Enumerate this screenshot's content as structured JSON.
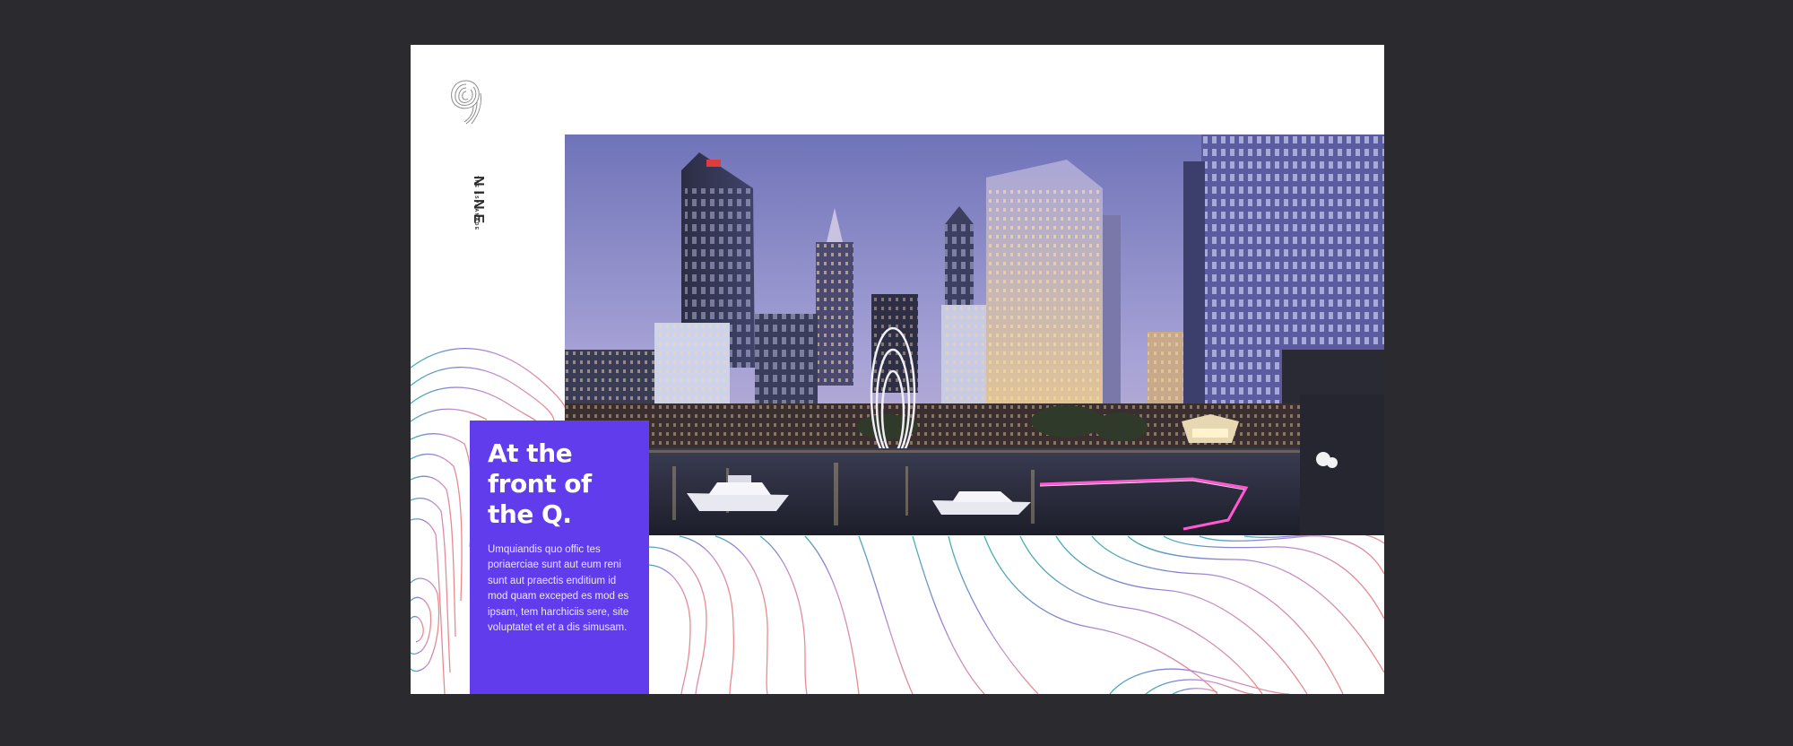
{
  "brand": {
    "logo_alt": "fingerprint-9-logo",
    "name": "NINE",
    "tagline": "THE ESPLANADE"
  },
  "hero": {
    "image": "night city skyline over waterfront with boats and arched sculpture"
  },
  "card": {
    "headline": "At the front of the Q.",
    "body": "Umquiandis quo offic tes poriaerciae sunt aut eum reni sunt aut praectis enditium id mod quam exceped es mod es ipsam, tem harchiciis sere, site voluptatet et et a dis simusam."
  },
  "colors": {
    "background": "#2b2a2f",
    "page": "#ffffff",
    "accent_purple": "#603cec",
    "contour_teal": "#3fb3b0",
    "contour_violet": "#8b7fd6",
    "contour_coral": "#ec8a8a"
  }
}
